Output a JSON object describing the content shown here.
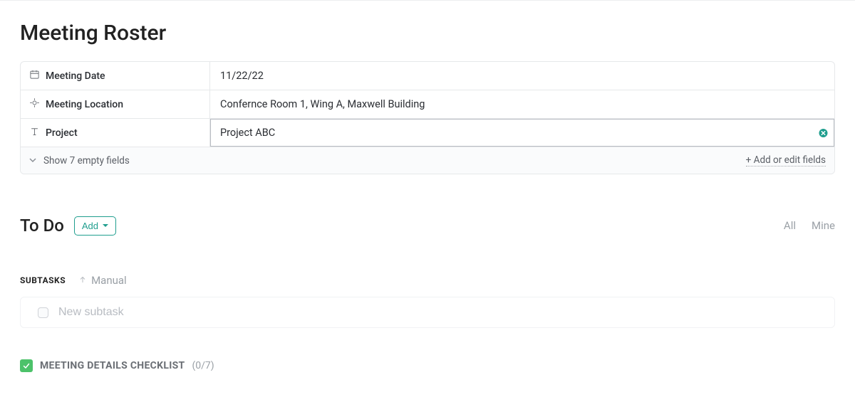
{
  "page": {
    "title": "Meeting Roster"
  },
  "fields": {
    "date": {
      "label": "Meeting Date",
      "value": "11/22/22"
    },
    "location": {
      "label": "Meeting Location",
      "value": "Confernce Room 1, Wing A, Maxwell Building"
    },
    "project": {
      "label": "Project",
      "value": "Project ABC"
    }
  },
  "footer": {
    "show_empty": "Show 7 empty fields",
    "add_edit": "+ Add or edit fields"
  },
  "todo": {
    "title": "To Do",
    "add_label": "Add",
    "filter_all": "All",
    "filter_mine": "Mine"
  },
  "subtasks": {
    "label": "SUBTASKS",
    "sort": "Manual",
    "placeholder": "New subtask"
  },
  "checklist": {
    "title": "MEETING DETAILS CHECKLIST",
    "count": "(0/7)"
  }
}
